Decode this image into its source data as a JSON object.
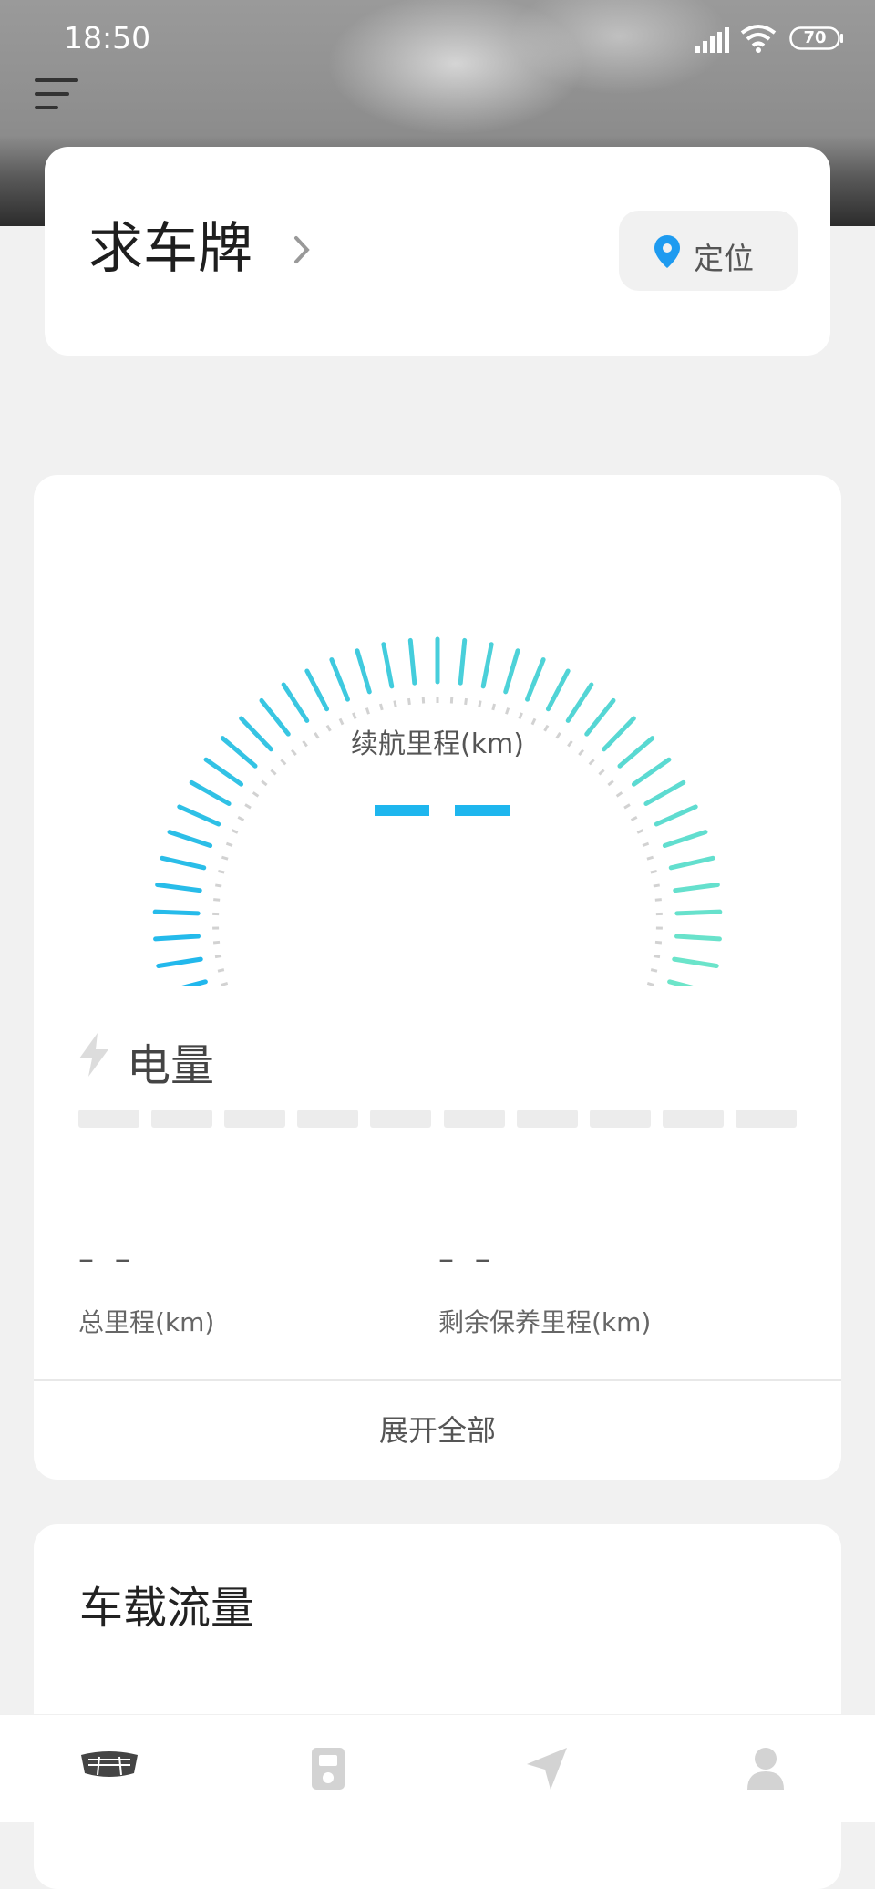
{
  "status_bar": {
    "time": "18:50",
    "battery": "70"
  },
  "location_card": {
    "plate_label": "求车牌",
    "locate_label": "定位"
  },
  "vehicle_card": {
    "range_label": "续航里程(km)",
    "battery_label": "电量",
    "stats": [
      {
        "value": "– –",
        "label": "总里程(km)"
      },
      {
        "value": "– –",
        "label": "剩余保养里程(km)"
      }
    ],
    "expand_label": "展开全部"
  },
  "traffic_card": {
    "title": "车载流量"
  },
  "tabs": [
    {
      "icon": "car-logo-icon"
    },
    {
      "icon": "device-icon"
    },
    {
      "icon": "navigation-icon"
    },
    {
      "icon": "person-icon"
    }
  ],
  "colors": {
    "gauge_start": "#1eb6ee",
    "gauge_end": "#6fe6c8",
    "accent": "#1e9bf0"
  }
}
